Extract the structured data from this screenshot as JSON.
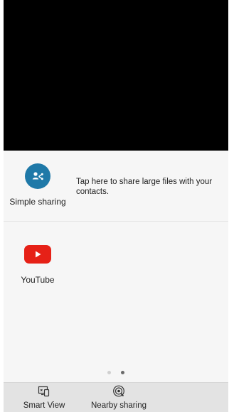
{
  "share_sheet": {
    "simple_sharing": {
      "label": "Simple sharing",
      "icon": "share-icon",
      "hint": "Tap here to share large files with your contacts."
    },
    "apps": [
      {
        "label": "YouTube",
        "icon": "youtube-icon"
      }
    ],
    "page_indicator": {
      "pages": 2,
      "current": 2
    }
  },
  "bottom_bar": {
    "smart_view": {
      "label": "Smart View",
      "icon": "smart-view-icon"
    },
    "nearby_sharing": {
      "label": "Nearby sharing",
      "icon": "nearby-sharing-icon"
    }
  },
  "colors": {
    "simple_sharing_icon": "#1f79a8",
    "youtube_icon": "#e62117",
    "sheet_background": "#f6f6f6",
    "bottom_bar_background": "#e3e3e3"
  }
}
